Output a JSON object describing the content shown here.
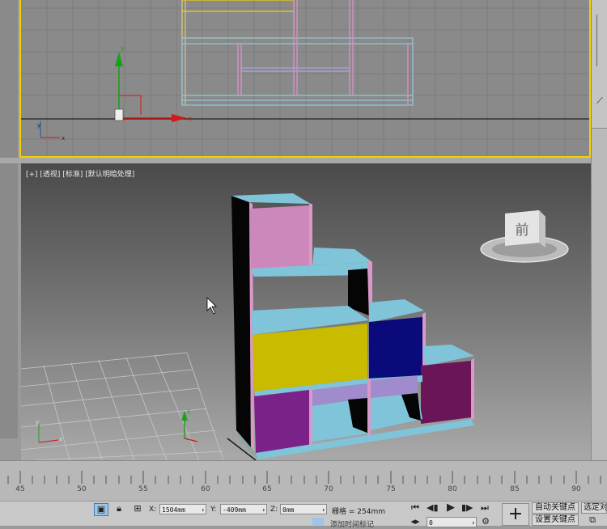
{
  "viewport_top": {
    "axis_labels": {
      "x": "x",
      "y": "y"
    },
    "mini_axis": {
      "x": "x",
      "y": "y"
    }
  },
  "viewport_perspective": {
    "label": "[+] [透视] [标准] [默认明暗处理]",
    "viewcube_face": "前",
    "mini_axis": {
      "x": "x",
      "y": "y",
      "z": "z"
    }
  },
  "timeline": {
    "ticks": [
      "45",
      "50",
      "55",
      "60",
      "65",
      "70",
      "75",
      "80",
      "85",
      "90"
    ]
  },
  "statusbar": {
    "x_label": "X:",
    "x_value": "1504mm",
    "y_label": "Y:",
    "y_value": "-409mm",
    "z_label": "Z:",
    "z_value": "0mm",
    "grid_text": "栅格 = 254mm",
    "auto_key": "自动关键点",
    "selected_dropdown": "选定对",
    "set_key": "设置关键点",
    "add_time_tag": "添加时间标记",
    "frame_value": "0"
  },
  "colors": {
    "selection_border": "#f2d100",
    "cabinet_frame": "#7fc4d8",
    "panel_pink": "#cc88bb",
    "panel_yellow": "#c8bb00",
    "panel_blue": "#0a0a7a",
    "panel_purple": "#7a2288",
    "panel_magenta": "#6a1558",
    "shelf_lavender": "#a08ccc"
  }
}
